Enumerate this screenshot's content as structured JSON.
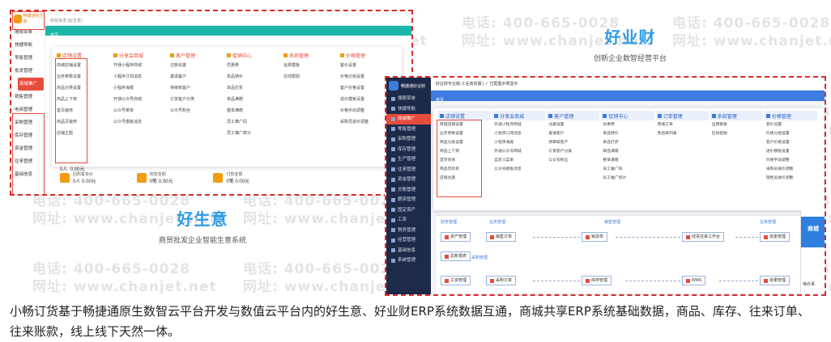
{
  "watermark": {
    "tel": "电话: 400-665-0028",
    "web": "网址: www.chanjet.net"
  },
  "shotA": {
    "logo_text": "畅捷通好生意",
    "tab": "首页",
    "topbar": "商贸批发 (好生意)",
    "sidebar": [
      "搜索菜单",
      "快捷导航",
      "零售管理",
      "批发管理",
      "商城推广",
      "销售管理",
      "电商管理",
      "采购管理",
      "库存管理",
      "资金管理",
      "往来管理",
      "基础信息"
    ],
    "sidebar_active_index": 4,
    "columns": [
      {
        "title": "店铺设置",
        "items": [
          "商城店铺设置",
          "业务参数设置",
          "商品分类设置",
          "商品上下架",
          "首页装修",
          "商品页装修",
          "店铺主题"
        ]
      },
      {
        "title": "分享会商城",
        "items": [
          "开通小程序商城",
          "小程序订阅消息",
          "小程序海报",
          "开通公众号商城",
          "公众号菜单",
          "公众号模板消息"
        ]
      },
      {
        "title": "客户管理",
        "items": [
          "注册设置",
          "邀请客户",
          "待审核客户",
          "订货客户分类",
          "公众号粉丝"
        ]
      },
      {
        "title": "促销中心",
        "items": [
          "优惠券",
          "单品特价",
          "单品打折",
          "单品满赠",
          "整单满赠",
          "员工推广码",
          "员工推广统计"
        ]
      },
      {
        "title": "系统管理",
        "items": [
          "运费模板",
          "在线帮助"
        ]
      },
      {
        "title": "价格管理",
        "items": [
          "客价设置",
          "价格分组设置",
          "客户价格设置",
          "进价模板设置",
          "价格手动调整",
          "采购员进价调整"
        ]
      }
    ],
    "stats_pre": [
      "0人",
      "0.00元"
    ],
    "stats": [
      {
        "label": "回购客单价",
        "value": "0人  0.00元"
      },
      {
        "label": "收款金额",
        "value": "0笔  0.00元"
      },
      {
        "label": "付款金额",
        "value": "0笔  0.00元"
      }
    ]
  },
  "brand1": {
    "name": "好生意",
    "sub": "商贸批发企业智能生意系统"
  },
  "brand2": {
    "name": "好业财",
    "sub": "创新企业数智经营平台"
  },
  "shotB": {
    "logo_text": "畅捷通好业财",
    "topbar": "好业财专业版-工业商贸版  |  ✓ 已配置示例显示",
    "tab": "首页",
    "sidebar": [
      "搜索菜单",
      "快捷导航",
      "商城推广",
      "零售管理",
      "采购管理",
      "库存管理",
      "生产管理",
      "往来管理",
      "资金管理",
      "总账管理",
      "薪资管理",
      "固定资产",
      "工资",
      "税务管理",
      "经营管理",
      "基础信息",
      "系统管理"
    ],
    "sidebar_active_index": 2,
    "columns": [
      {
        "title": "店铺设置",
        "items": [
          "商城店铺设置",
          "业务参数设置",
          "商品分类设置",
          "商品上下架",
          "首页装修",
          "商品页装修",
          "店铺主题"
        ]
      },
      {
        "title": "分享会商城",
        "items": [
          "开通小程序商城",
          "小程序订阅消息",
          "小程序海报",
          "开通公众号商城",
          "自定义菜单",
          "公众号模板消息"
        ]
      },
      {
        "title": "客户管理",
        "items": [
          "注册设置",
          "邀请客户",
          "待审核客户",
          "订货客户分类",
          "公众号粉丝"
        ]
      },
      {
        "title": "促销中心",
        "items": [
          "优惠券",
          "单品特价",
          "单品打折",
          "单品满赠",
          "整单满赠",
          "员工推广码",
          "员工推广统计"
        ]
      },
      {
        "title": "订单管理",
        "items": [
          "商城订单",
          "售后单列表"
        ]
      },
      {
        "title": "系统管理",
        "items": [
          "运费模板",
          "在线帮助"
        ]
      },
      {
        "title": "价格管理",
        "items": [
          "客价设置",
          "价格分组设置",
          "客户价格设置",
          "进价模板设置",
          "价格手动调整",
          "采购员进价调整",
          "销售员进价调整"
        ]
      }
    ],
    "flow": {
      "groups": [
        "财务管理",
        "业务管理",
        "销售管理",
        "往来管理",
        "采购管理",
        "库存管理"
      ],
      "nodes": [
        "资产管理",
        "销售订单",
        "销货单",
        "线货往来工作台",
        "资金管理",
        "总账报表",
        "工资管理",
        "采购订单",
        "库存管理",
        "WMS",
        "批量管理"
      ]
    },
    "right_card": {
      "big": "商城",
      "small": "待办事"
    }
  },
  "caption": "小畅订货基于畅捷通原生数智云平台开发与数值云平台内的好生意、好业财ERP系统数据互通，商城共享ERP系统基础数据，商品、库存、往来订单、往来账款，线上线下天然一体。"
}
